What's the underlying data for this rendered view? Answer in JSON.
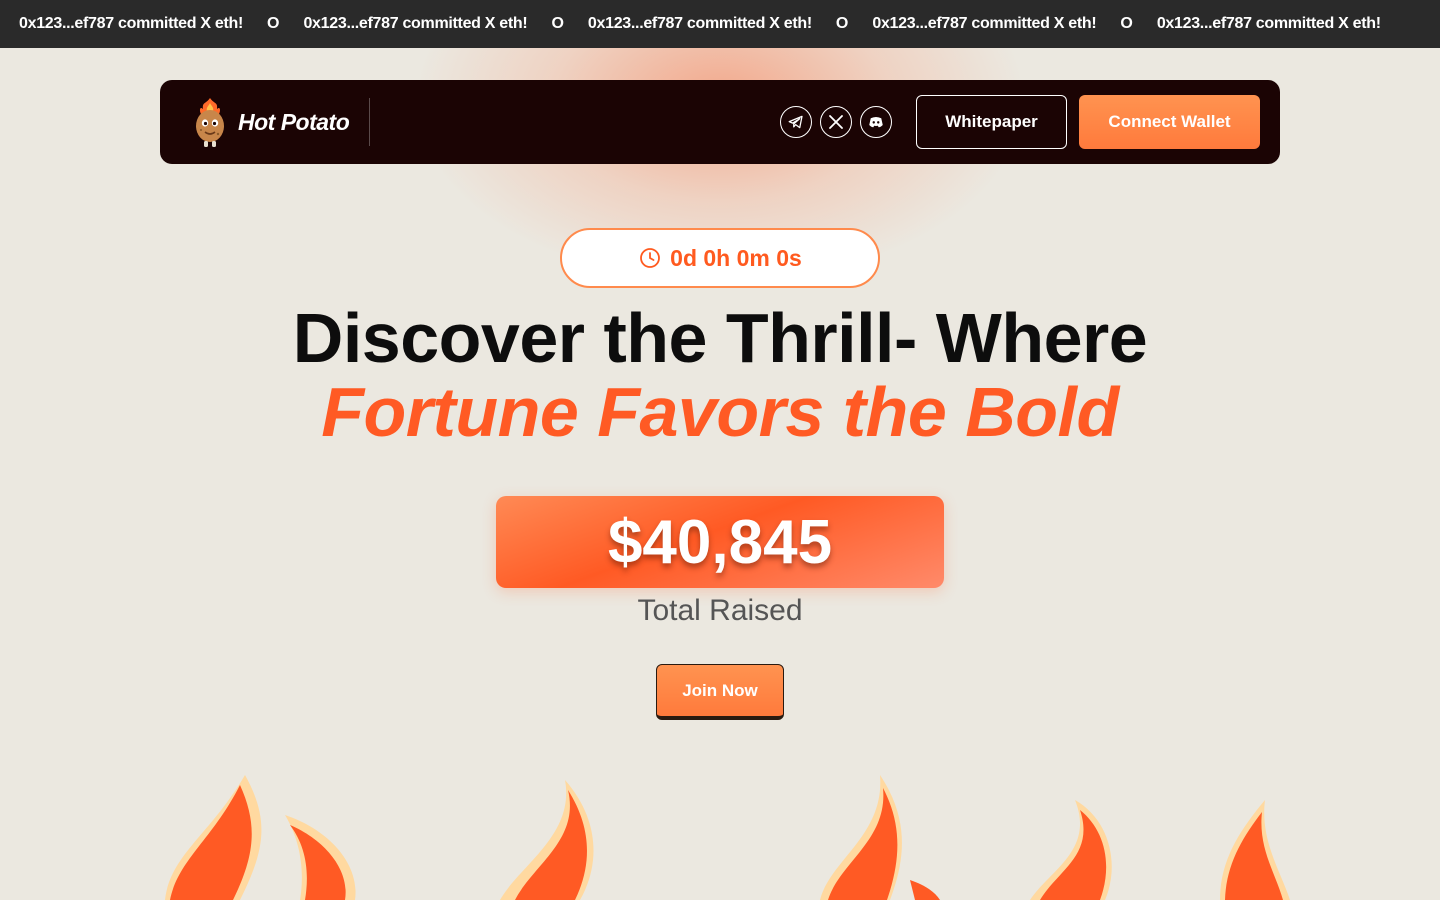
{
  "ticker": {
    "items": [
      "0x123...ef787 committed X eth!",
      "0x123...ef787 committed X eth!",
      "0x123...ef787 committed X eth!",
      "0x123...ef787 committed X eth!",
      "0x123...ef787 committed X eth!"
    ],
    "separator": "O"
  },
  "nav": {
    "brand": "Hot Potato",
    "socials": [
      "telegram-icon",
      "x-icon",
      "discord-icon"
    ],
    "whitepaper_label": "Whitepaper",
    "connect_label": "Connect Wallet"
  },
  "countdown": {
    "icon": "clock-icon",
    "text": "0d 0h 0m 0s"
  },
  "hero": {
    "line1": "Discover the Thrill- Where",
    "line2": "Fortune Favors the Bold"
  },
  "raised": {
    "amount": "$40,845",
    "label": "Total Raised"
  },
  "cta": {
    "join_label": "Join Now"
  },
  "colors": {
    "accent": "#ff5a24",
    "button": "#ff8546",
    "nav_bg": "#1b0404",
    "page_bg": "#ebe8e0",
    "ticker_bg": "#2a2a2a"
  }
}
